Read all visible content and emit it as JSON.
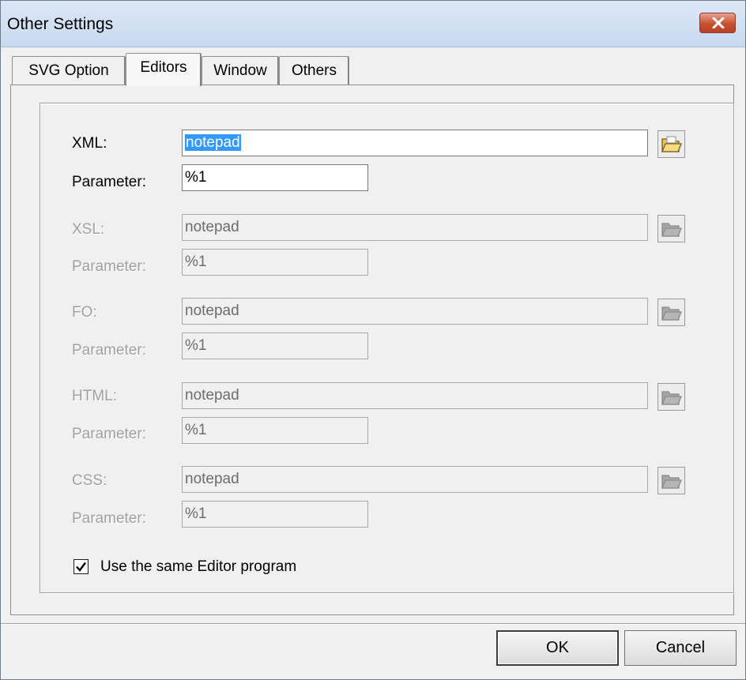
{
  "window": {
    "title": "Other Settings",
    "close_icon": "close-icon"
  },
  "tabs": [
    {
      "label": "SVG Option",
      "active": false
    },
    {
      "label": "Editors",
      "active": true
    },
    {
      "label": "Window",
      "active": false
    },
    {
      "label": "Others",
      "active": false
    }
  ],
  "editors": {
    "xml": {
      "label": "XML:",
      "value": "notepad",
      "param_label": "Parameter:",
      "param_value": "%1",
      "enabled": true
    },
    "xsl": {
      "label": "XSL:",
      "value": "notepad",
      "param_label": "Parameter:",
      "param_value": "%1",
      "enabled": false
    },
    "fo": {
      "label": "FO:",
      "value": "notepad",
      "param_label": "Parameter:",
      "param_value": "%1",
      "enabled": false
    },
    "html": {
      "label": "HTML:",
      "value": "notepad",
      "param_label": "Parameter:",
      "param_value": "%1",
      "enabled": false
    },
    "css": {
      "label": "CSS:",
      "value": "notepad",
      "param_label": "Parameter:",
      "param_value": "%1",
      "enabled": false
    }
  },
  "same_editor": {
    "label": "Use the same Editor program",
    "checked": true
  },
  "buttons": {
    "ok": "OK",
    "cancel": "Cancel"
  },
  "colors": {
    "selection": "#3399ff",
    "disabled_text": "#a0a0a0",
    "close_button": "#c9502f"
  }
}
